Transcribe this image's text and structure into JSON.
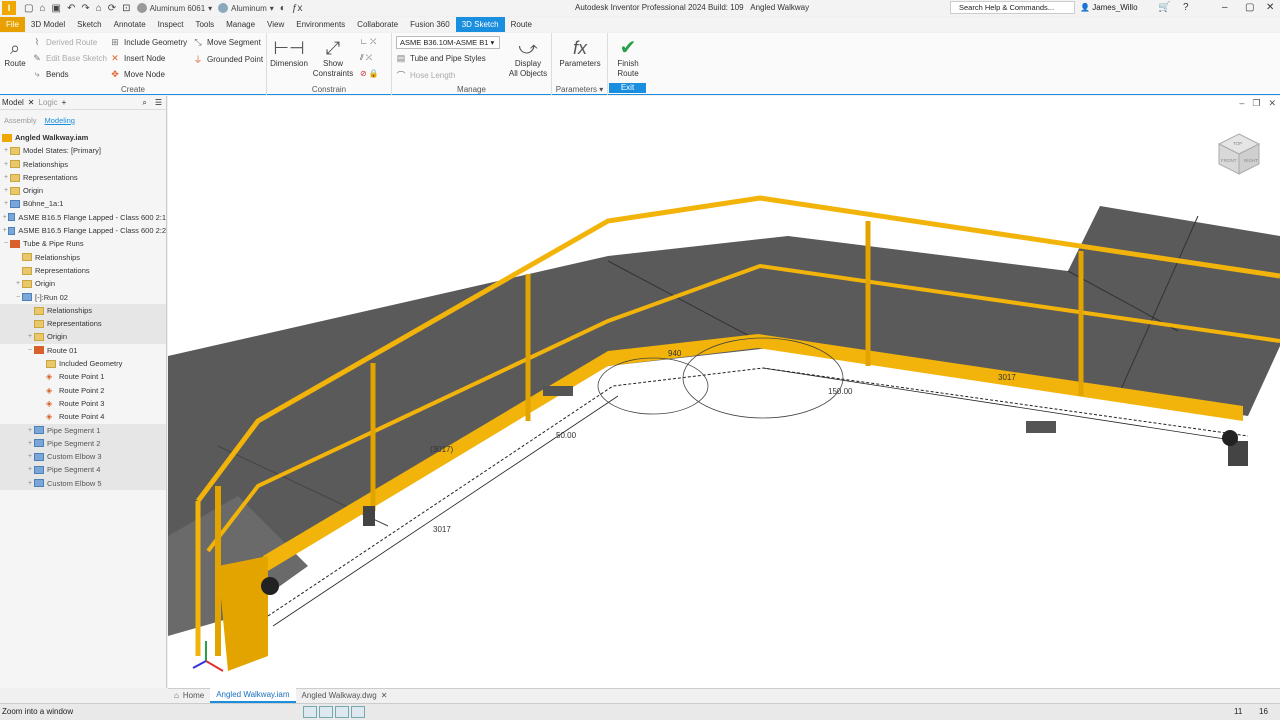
{
  "app": {
    "logo": "I",
    "title": "Autodesk Inventor Professional 2024 Build: 109",
    "doc_title": "Angled Walkway",
    "search_placeholder": "Search Help & Commands...",
    "user": "James_Willo",
    "material_1": "Aluminum 6061",
    "material_2": "Aluminum"
  },
  "menu": [
    "File",
    "3D Model",
    "Sketch",
    "Annotate",
    "Inspect",
    "Tools",
    "Manage",
    "View",
    "Environments",
    "Collaborate",
    "Fusion 360",
    "3D Sketch",
    "Route"
  ],
  "ribbon": {
    "create": {
      "label": "Create",
      "route": "Route",
      "derived_route": "Derived Route",
      "edit_base_sketch": "Edit Base Sketch",
      "bends": "Bends",
      "include_geometry": "Include Geometry",
      "insert_node": "Insert Node",
      "move_node": "Move Node",
      "move_segment": "Move Segment",
      "grounded_point": "Grounded Point"
    },
    "constrain": {
      "label": "Constrain",
      "dimension": "Dimension",
      "show_constraints_1": "Show",
      "show_constraints_2": "Constraints"
    },
    "manage": {
      "label": "Manage",
      "style_select": "ASME B36.10M-ASME B1",
      "tube_pipe_styles": "Tube and Pipe Styles",
      "hose_length": "Hose Length",
      "display_1": "Display",
      "display_2": "All Objects"
    },
    "parameters": {
      "label": "Parameters",
      "button": "Parameters"
    },
    "exit": {
      "label": "Exit",
      "finish_1": "Finish",
      "finish_2": "Route"
    }
  },
  "browser": {
    "tab_model": "Model",
    "tab_logic": "Logic",
    "sub_assembly": "Assembly",
    "sub_modeling": "Modeling",
    "nodes": [
      {
        "label": "Angled Walkway.iam"
      },
      {
        "label": "Model States: [Primary]"
      },
      {
        "label": "Relationships"
      },
      {
        "label": "Representations"
      },
      {
        "label": "Origin"
      },
      {
        "label": "Bühne_1a:1"
      },
      {
        "label": "ASME B16.5 Flange Lapped - Class 600 2:1"
      },
      {
        "label": "ASME B16.5 Flange Lapped - Class 600 2:2"
      },
      {
        "label": "Tube & Pipe Runs"
      },
      {
        "label": "Relationships"
      },
      {
        "label": "Representations"
      },
      {
        "label": "Origin"
      },
      {
        "label": "[-]:Run 02"
      },
      {
        "label": "Relationships"
      },
      {
        "label": "Representations"
      },
      {
        "label": "Origin"
      },
      {
        "label": "Route 01"
      },
      {
        "label": "Included Geometry"
      },
      {
        "label": "Route Point 1"
      },
      {
        "label": "Route Point 2"
      },
      {
        "label": "Route Point 3"
      },
      {
        "label": "Route Point 4"
      },
      {
        "label": "Pipe Segment 1"
      },
      {
        "label": "Pipe Segment 2"
      },
      {
        "label": "Custom Elbow 3"
      },
      {
        "label": "Pipe Segment 4"
      },
      {
        "label": "Custom Elbow 5"
      }
    ]
  },
  "viewport": {
    "dims": {
      "d1": "940",
      "d2": "3017",
      "d3": "150.00",
      "d4": "(3017)",
      "d5": "3017",
      "d6": "50.00"
    },
    "cube_front": "FRONT",
    "cube_right": "RIGHT",
    "cube_top": "TOP"
  },
  "doctabs": {
    "home": "Home",
    "tab1": "Angled Walkway.iam",
    "tab2": "Angled Walkway.dwg"
  },
  "status": {
    "text": "Zoom into a window",
    "n1": "11",
    "n2": "16"
  },
  "colors": {
    "accent": "#1a8fe0",
    "file": "#e8a000",
    "rail": "#f2b40a",
    "deck": "#5a5a5a"
  }
}
